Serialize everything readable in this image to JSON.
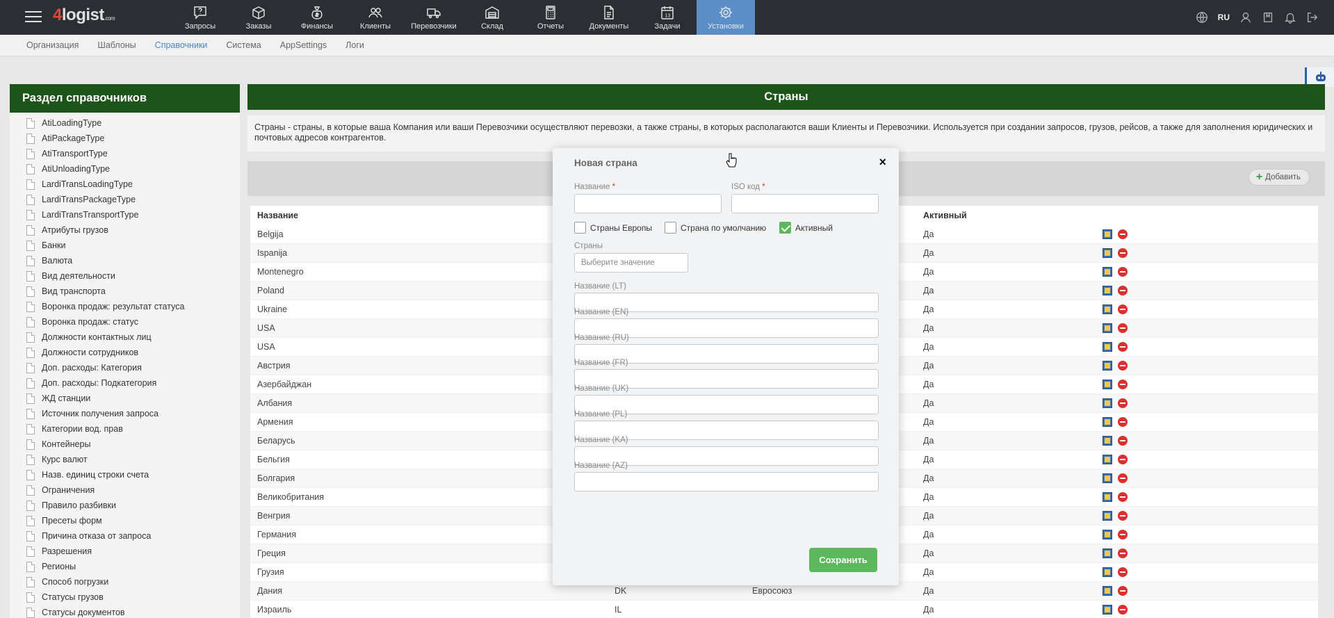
{
  "app": {
    "logo_four": "4",
    "logo_text": "logist",
    "logo_com": ".com"
  },
  "nav": [
    {
      "label": "Запросы",
      "icon": "question-chat-icon"
    },
    {
      "label": "Заказы",
      "icon": "box-icon"
    },
    {
      "label": "Финансы",
      "icon": "money-bag-icon"
    },
    {
      "label": "Клиенты",
      "icon": "users-icon"
    },
    {
      "label": "Перевозчики",
      "icon": "truck-icon"
    },
    {
      "label": "Склад",
      "icon": "warehouse-icon"
    },
    {
      "label": "Отчеты",
      "icon": "calculator-icon"
    },
    {
      "label": "Документы",
      "icon": "document-icon"
    },
    {
      "label": "Задачи",
      "icon": "calendar-icon"
    },
    {
      "label": "Установки",
      "icon": "gear-icon",
      "active": true
    }
  ],
  "topright": {
    "lang": "RU"
  },
  "subnav": [
    "Организация",
    "Шаблоны",
    "Справочники",
    "Система",
    "AppSettings",
    "Логи"
  ],
  "subnav_active": "Справочники",
  "sidebar": {
    "title": "Раздел справочников",
    "items": [
      "AtiLoadingType",
      "AtiPackageType",
      "AtiTransportType",
      "AtiUnloadingType",
      "LardiTransLoadingType",
      "LardiTransPackageType",
      "LardiTransTransportType",
      "Атрибуты грузов",
      "Банки",
      "Валюта",
      "Вид деятельности",
      "Вид транспорта",
      "Воронка продаж: результат статуса",
      "Воронка продаж: статус",
      "Должности контактных лиц",
      "Должности сотрудников",
      "Доп. расходы: Категория",
      "Доп. расходы: Подкатегория",
      "ЖД станции",
      "Источник получения запроса",
      "Категории вод. прав",
      "Контейнеры",
      "Курс валют",
      "Назв. единиц строки счета",
      "Ограничения",
      "Правило разбивки",
      "Пресеты форм",
      "Причина отказа от запроса",
      "Разрешения",
      "Регионы",
      "Способ погрузки",
      "Статусы грузов",
      "Статусы документов"
    ]
  },
  "main": {
    "title": "Страны",
    "description": "Страны - страны, в которые ваша Компания или ваши Перевозчики осуществляют перевозки, а также страны, в которых располагаются ваши Клиенты и Перевозчики. Используется при создании запросов, грузов, рейсов, а также для заполнения юридических и почтовых адресов контрагентов.",
    "add_label": "Добавить"
  },
  "table": {
    "headers": {
      "name": "Название",
      "active": "Активный"
    },
    "rows": [
      {
        "name": "Belgija",
        "iso": "",
        "group": "",
        "active": "Да"
      },
      {
        "name": "Ispanija",
        "iso": "",
        "group": "",
        "active": "Да"
      },
      {
        "name": "Montenegro",
        "iso": "",
        "group": "",
        "active": "Да"
      },
      {
        "name": "Poland",
        "iso": "",
        "group": "",
        "active": "Да"
      },
      {
        "name": "Ukraine",
        "iso": "",
        "group": "",
        "active": "Да"
      },
      {
        "name": "USA",
        "iso": "",
        "group": "",
        "active": "Да"
      },
      {
        "name": "USA",
        "iso": "",
        "group": "",
        "active": "Да"
      },
      {
        "name": "Австрия",
        "iso": "",
        "group": "",
        "active": "Да"
      },
      {
        "name": "Азербайджан",
        "iso": "",
        "group": "",
        "active": "Да"
      },
      {
        "name": "Албания",
        "iso": "",
        "group": "",
        "active": "Да"
      },
      {
        "name": "Армения",
        "iso": "",
        "group": "",
        "active": "Да"
      },
      {
        "name": "Беларусь",
        "iso": "",
        "group": "",
        "active": "Да"
      },
      {
        "name": "Бельгия",
        "iso": "",
        "group": "",
        "active": "Да"
      },
      {
        "name": "Болгария",
        "iso": "",
        "group": "",
        "active": "Да"
      },
      {
        "name": "Великобритания",
        "iso": "",
        "group": "",
        "active": "Да"
      },
      {
        "name": "Венгрия",
        "iso": "",
        "group": "",
        "active": "Да"
      },
      {
        "name": "Германия",
        "iso": "",
        "group": "",
        "active": "Да"
      },
      {
        "name": "Греция",
        "iso": "",
        "group": "",
        "active": "Да"
      },
      {
        "name": "Грузия",
        "iso": "",
        "group": "",
        "active": "Да"
      },
      {
        "name": "Дания",
        "iso": "DK",
        "group": "Евросоюз",
        "active": "Да"
      },
      {
        "name": "Израиль",
        "iso": "IL",
        "group": "",
        "active": "Да"
      }
    ]
  },
  "modal": {
    "title": "Новая страна",
    "name_label": "Название",
    "iso_label": "ISO код",
    "required_mark": "*",
    "cb_europe": "Страны Европы",
    "cb_default": "Страна по умолчанию",
    "cb_active": "Активный",
    "countries_label": "Страны",
    "countries_placeholder": "Выберите значение",
    "lang_fields": [
      "Название (LT)",
      "Название (EN)",
      "Название (RU)",
      "Название (FR)",
      "Название (UK)",
      "Название (PL)",
      "Название (KA)",
      "Название (AZ)"
    ],
    "save_label": "Сохранить",
    "close": "×"
  },
  "colors": {
    "header_green": "#1d5419",
    "nav_active": "#5b8ec7",
    "save_green": "#5cb85c",
    "link_blue": "#4a86c6"
  }
}
